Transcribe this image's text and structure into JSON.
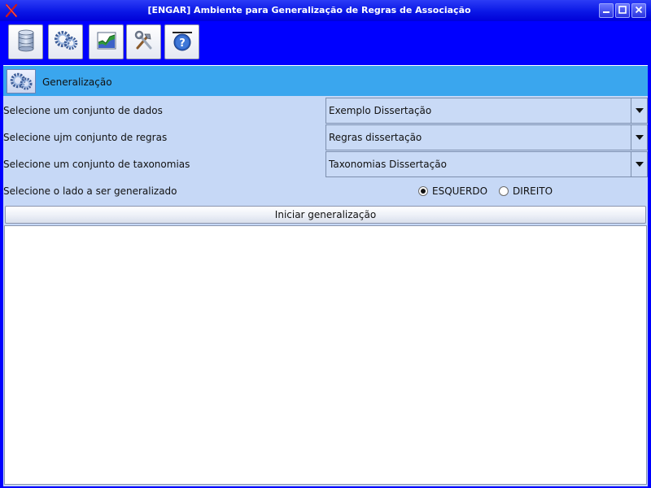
{
  "window": {
    "title": "[ENGAR] Ambiente para Generalização de Regras de Associação",
    "icon": "red-x-app-icon",
    "controls": [
      "minimize",
      "maximize",
      "close"
    ]
  },
  "toolbar": {
    "buttons": [
      {
        "icon": "database-icon"
      },
      {
        "icon": "gears-icon"
      },
      {
        "icon": "chart-icon"
      },
      {
        "icon": "tools-icon"
      },
      {
        "icon": "help-icon"
      }
    ]
  },
  "section": {
    "title": "Generalização",
    "icon": "gears-icon"
  },
  "form": {
    "dataset_label": "Selecione um conjunto de dados",
    "dataset_value": "Exemplo Dissertação",
    "rules_label": "Selecione ujm conjunto de regras",
    "rules_value": "Regras dissertação",
    "taxonomy_label": "Selecione um conjunto de taxonomias",
    "taxonomy_value": "Taxonomias Dissertação",
    "side_label": "Selecione o lado a ser generalizado",
    "side_options": [
      {
        "label": "ESQUERDO",
        "selected": true
      },
      {
        "label": "DIREITO",
        "selected": false
      }
    ],
    "start_button": "Iniciar generalização"
  },
  "colors": {
    "window_bg": "#0000ff",
    "section_header": "#3aa6ee",
    "panel_bg": "#c6d8f6",
    "title_bar": "#0a17e6"
  }
}
